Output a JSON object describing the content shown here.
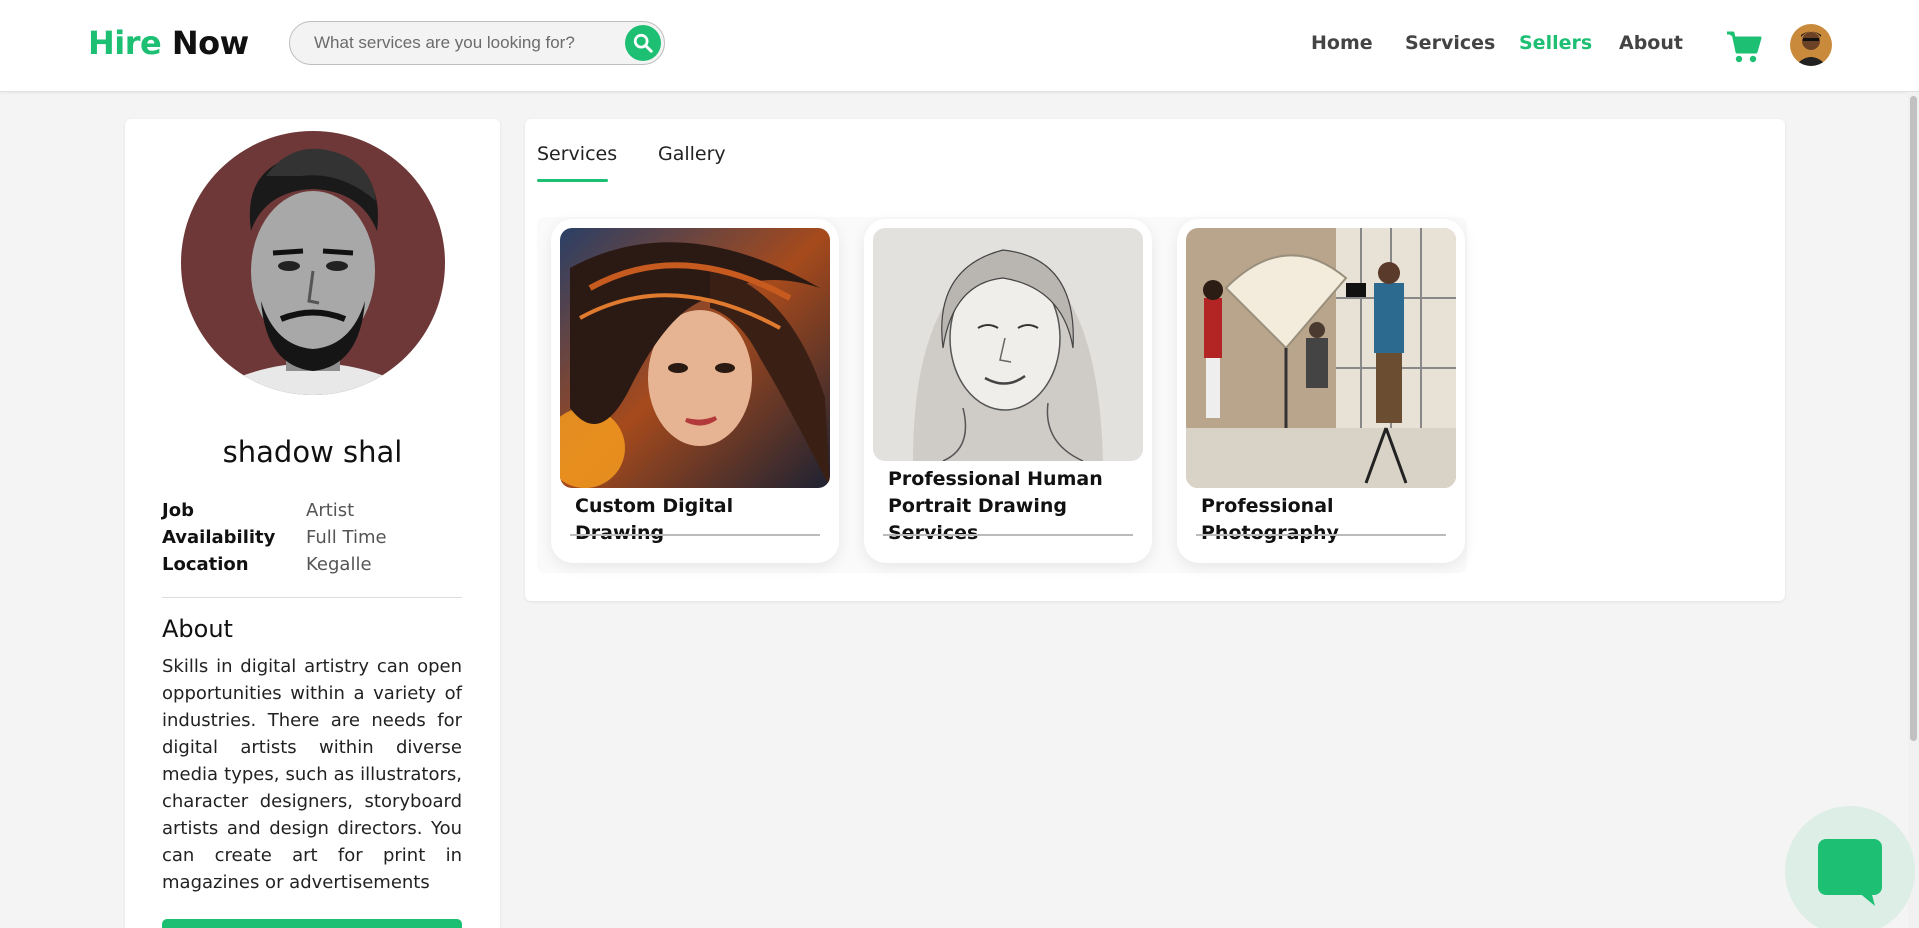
{
  "header": {
    "logo_hire": "Hire",
    "logo_now": "Now",
    "search_placeholder": "What services are you looking for?",
    "nav": [
      {
        "label": "Home",
        "active": false
      },
      {
        "label": "Services",
        "active": false
      },
      {
        "label": "Sellers",
        "active": true
      },
      {
        "label": "About",
        "active": false
      }
    ],
    "accent_color": "#1dbf73"
  },
  "profile": {
    "name": "shadow shal",
    "info": [
      {
        "key": "Job",
        "value": "Artist"
      },
      {
        "key": "Availability",
        "value": "Full Time"
      },
      {
        "key": "Location",
        "value": "Kegalle"
      }
    ],
    "about_title": "About",
    "about_text": "Skills in digital artistry can open opportunities within a variety of industries. There are needs for digital artists within diverse media types, such as illustrators, character designers, storyboard artists and design directors. You can create art for print in magazines or advertisements"
  },
  "tabs": [
    {
      "label": "Services",
      "active": true
    },
    {
      "label": "Gallery",
      "active": false
    }
  ],
  "gigs": [
    {
      "title": "Custom Digital Drawing"
    },
    {
      "title": "Professional Human Portrait Drawing Services"
    },
    {
      "title": "Professional Photography"
    }
  ],
  "icons": [
    "search-icon",
    "cart-icon",
    "chat-icon"
  ]
}
